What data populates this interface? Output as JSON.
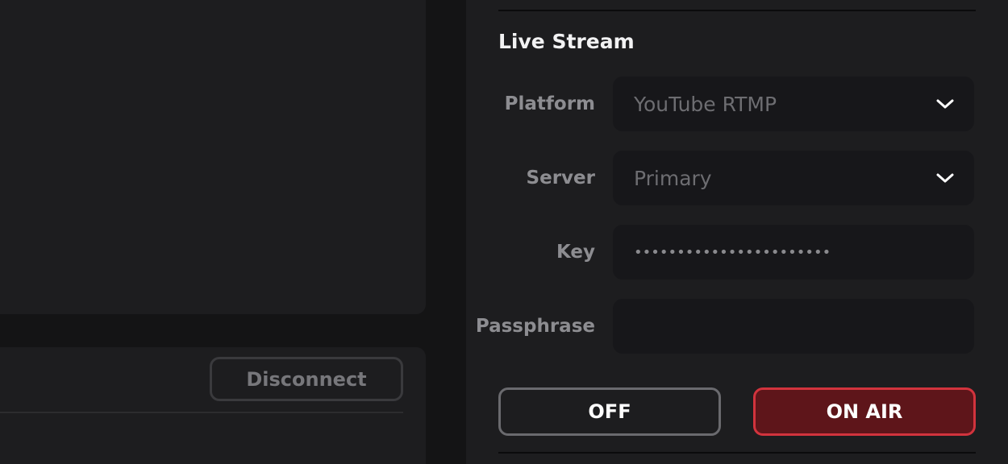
{
  "connection": {
    "disconnect_label": "Disconnect"
  },
  "live_stream": {
    "title": "Live Stream",
    "platform": {
      "label": "Platform",
      "value": "YouTube RTMP",
      "icon": "chevron-down-icon"
    },
    "server": {
      "label": "Server",
      "value": "Primary",
      "icon": "chevron-down-icon"
    },
    "key": {
      "label": "Key",
      "value": "•••••••••••••••••••••••"
    },
    "passphrase": {
      "label": "Passphrase",
      "value": ""
    },
    "off_label": "OFF",
    "on_air_label": "ON AIR"
  },
  "colors": {
    "on_air_border": "#d2333d",
    "on_air_fill": "#5e151a",
    "panel_bg": "#1d1d1f",
    "page_bg": "#141415"
  }
}
